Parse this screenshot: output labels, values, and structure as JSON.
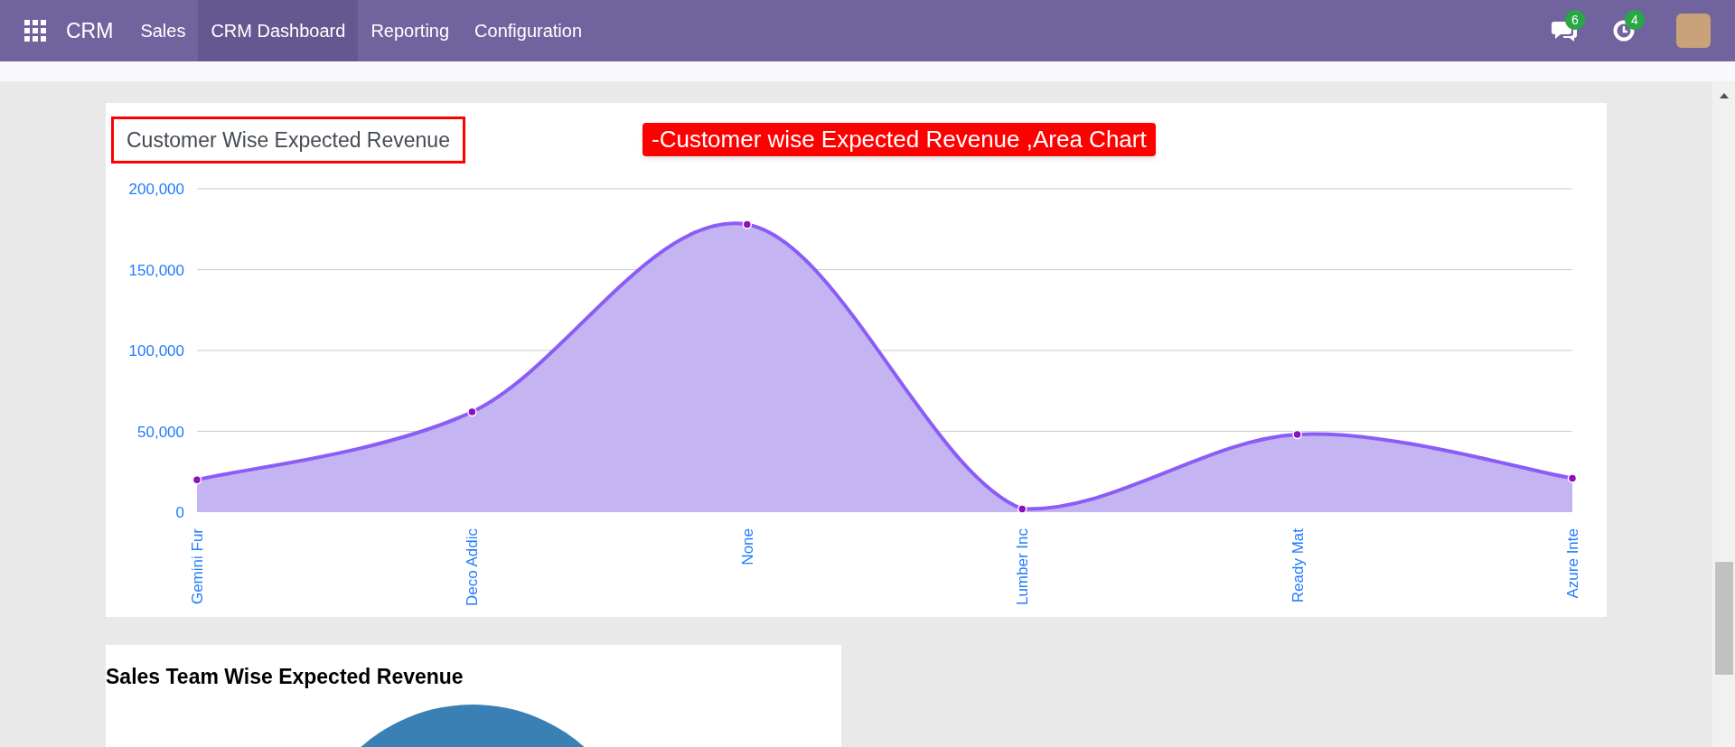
{
  "navbar": {
    "app_name": "CRM",
    "menu": [
      {
        "label": "Sales",
        "selected": false
      },
      {
        "label": "CRM Dashboard",
        "selected": true
      },
      {
        "label": "Reporting",
        "selected": false
      },
      {
        "label": "Configuration",
        "selected": false
      }
    ],
    "messages_badge": "6",
    "activities_badge": "4"
  },
  "area_chart_card": {
    "title": "Customer Wise Expected Revenue",
    "title_highlighted": true,
    "annotation": "-Customer wise Expected Revenue ,Area Chart",
    "chart_data": {
      "type": "area",
      "categories": [
        "Gemini Fur",
        "Deco Addic",
        "None",
        "Lumber Inc",
        "Ready Mat",
        "Azure Inte"
      ],
      "series": [
        {
          "color": "#8b5cf6",
          "values": [
            20000,
            62000,
            178000,
            2000,
            48000,
            21000
          ]
        }
      ],
      "ylim": [
        0,
        200000
      ],
      "grid": true,
      "yticks": [
        {
          "value": 0,
          "label": "0"
        },
        {
          "value": 50000,
          "label": "50,000"
        },
        {
          "value": 100000,
          "label": "100,000"
        },
        {
          "value": 150000,
          "label": "150,000"
        },
        {
          "value": 200000,
          "label": "200,000"
        }
      ]
    }
  },
  "pie_chart_card": {
    "title": "Sales Team Wise Expected Revenue"
  }
}
